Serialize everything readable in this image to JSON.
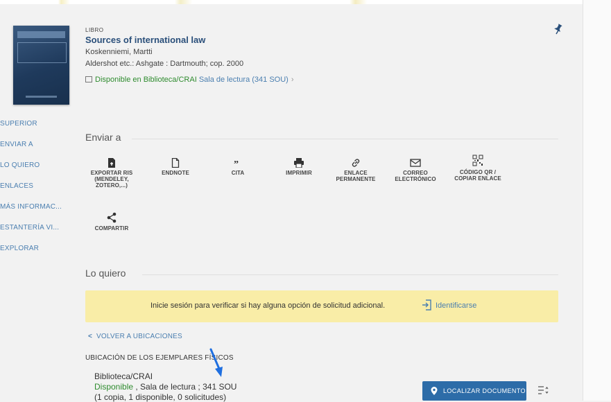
{
  "record": {
    "type": "LIBRO",
    "title": "Sources of international law",
    "author": "Koskenniemi, Martti",
    "publisher": "Aldershot etc.: Ashgate : Dartmouth; cop. 2000",
    "availability": {
      "status": "Disponible en Biblioteca/CRAI",
      "location": "Sala de lectura (341 SOU)"
    }
  },
  "sidenav": {
    "items": [
      {
        "label": "SUPERIOR"
      },
      {
        "label": "ENVIAR A"
      },
      {
        "label": "LO QUIERO"
      },
      {
        "label": "ENLACES"
      },
      {
        "label": "MÁS INFORMAC..."
      },
      {
        "label": "ESTANTERÍA VI..."
      },
      {
        "label": "EXPLORAR"
      }
    ]
  },
  "send_to": {
    "title": "Enviar a",
    "actions": [
      {
        "label": "EXPORTAR RIS (MENDELEY, ZOTERO,...)",
        "icon": "export-file-icon"
      },
      {
        "label": "ENDNOTE",
        "icon": "document-icon"
      },
      {
        "label": "CITA",
        "icon": "quote-icon"
      },
      {
        "label": "IMPRIMIR",
        "icon": "printer-icon"
      },
      {
        "label": "ENLACE PERMANENTE",
        "icon": "link-icon"
      },
      {
        "label": "CORREO ELECTRÓNICO",
        "icon": "mail-icon"
      },
      {
        "label": "CÓDIGO QR / COPIAR ENLACE",
        "icon": "qr-code-icon"
      },
      {
        "label": "COMPARTIR",
        "icon": "share-icon"
      }
    ]
  },
  "want": {
    "title": "Lo quiero",
    "login_message": "Inicie sesión para verificar si hay alguna opción de solicitud adicional.",
    "login_link": "Identificarse",
    "back_link": "VOLVER A UBICACIONES",
    "holdings_title": "UBICACIÓN DE LOS EJEMPLARES FÍSICOS",
    "library": "Biblioteca/CRAI",
    "status": "Disponible",
    "status_detail": " , Sala de lectura ; 341 SOU",
    "copies": "(1 copia, 1 disponible, 0 solicitudes)",
    "locate_button": "LOCALIZAR DOCUMENTO"
  },
  "colors": {
    "link": "#4b7fb0",
    "available": "#2e8b2e",
    "banner": "#f9eda7",
    "primary_button": "#2d6ca8"
  }
}
